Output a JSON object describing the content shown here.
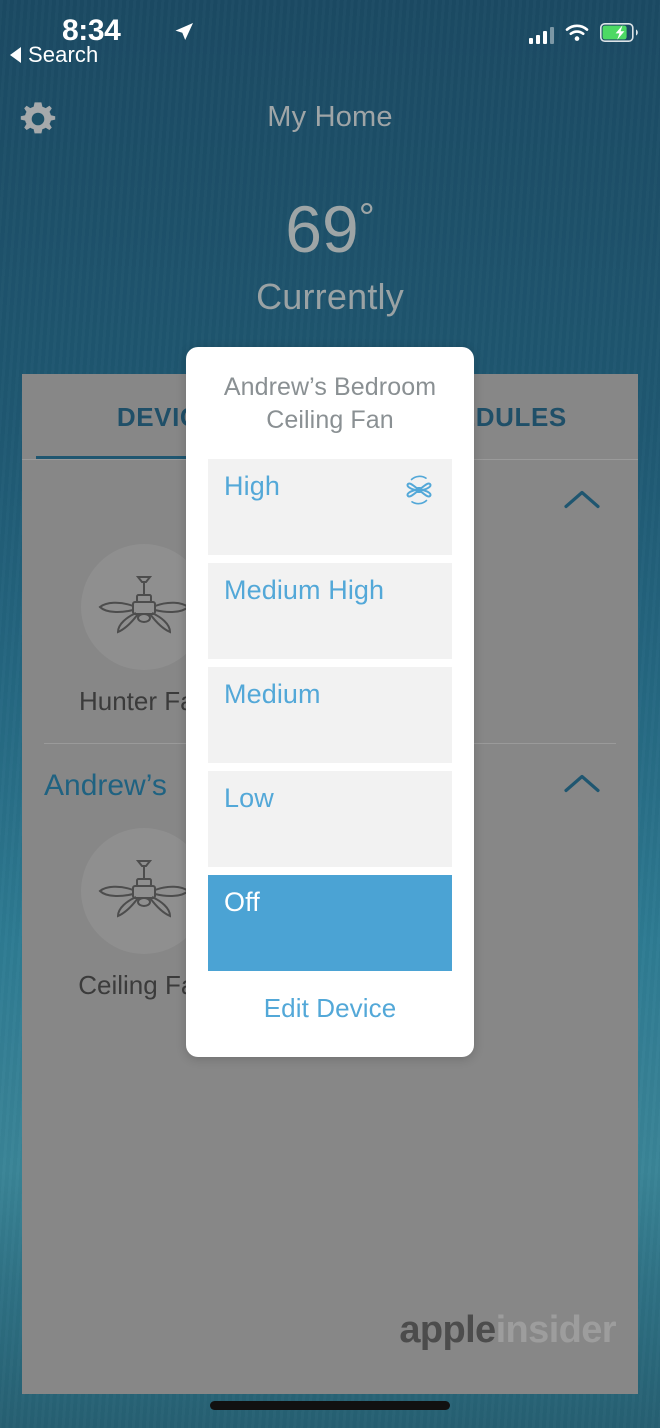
{
  "status_bar": {
    "time": "8:34",
    "location_icon": "location-arrow-icon",
    "back_link": "Search",
    "cellular_icon": "cellular-bars-icon",
    "wifi_icon": "wifi-icon",
    "battery_icon": "battery-charging-icon",
    "battery_color": "#4cd964"
  },
  "nav": {
    "settings_icon": "gear-icon",
    "title": "My Home"
  },
  "weather": {
    "temperature": "69",
    "degree_symbol": "°",
    "condition": "Currently"
  },
  "app": {
    "tabs": [
      {
        "label": "DEVICES",
        "active": true
      },
      {
        "label": "SCHEDULES",
        "active": false
      }
    ],
    "sections": [
      {
        "title": "",
        "collapse_icon": "chevron-up-icon",
        "devices": [
          {
            "name": "Hunter Fan",
            "icon": "ceiling-fan-icon"
          }
        ]
      },
      {
        "title": "Andrew’s",
        "collapse_icon": "chevron-up-icon",
        "devices": [
          {
            "name": "Ceiling Fan",
            "icon": "ceiling-fan-icon"
          }
        ]
      }
    ],
    "watermark": {
      "bold": "apple",
      "light": "insider"
    }
  },
  "modal": {
    "title_line1": "Andrew’s Bedroom",
    "title_line2": "Ceiling Fan",
    "options": [
      {
        "label": "High",
        "selected": false,
        "icon": "fan-speed-icon"
      },
      {
        "label": "Medium High",
        "selected": false,
        "icon": ""
      },
      {
        "label": "Medium",
        "selected": false,
        "icon": ""
      },
      {
        "label": "Low",
        "selected": false,
        "icon": ""
      },
      {
        "label": "Off",
        "selected": true,
        "icon": ""
      }
    ],
    "edit_link": "Edit Device",
    "accent_color": "#53a8d8",
    "selected_bg": "#4ba3d4",
    "row_bg": "#f2f2f2"
  }
}
